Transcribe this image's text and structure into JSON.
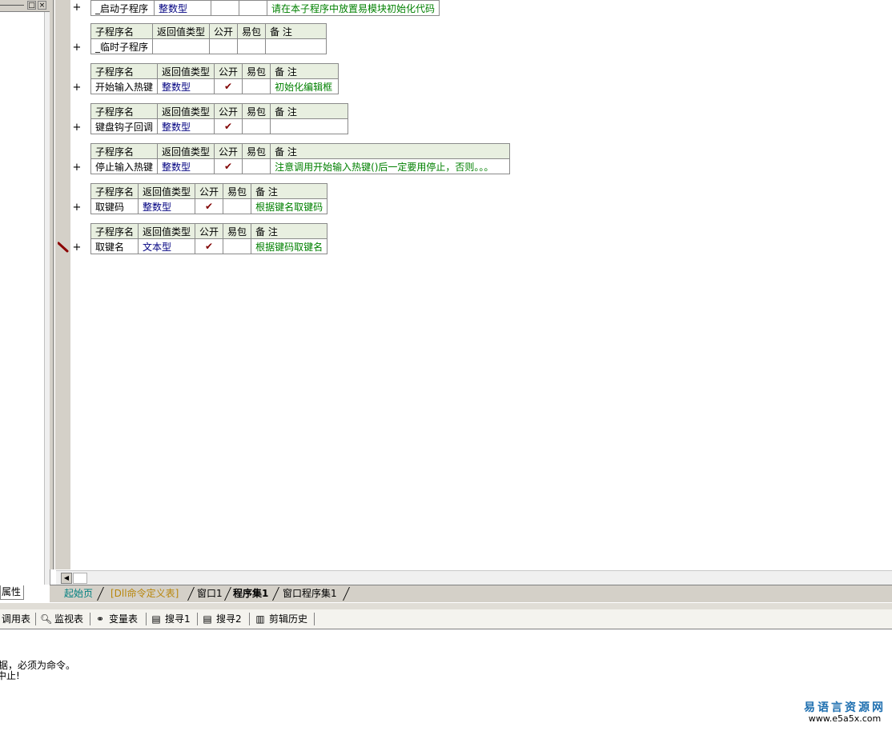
{
  "left_panel": {
    "buttons": [
      "□",
      "×"
    ],
    "properties_tab": "属性"
  },
  "procedures": [
    {
      "header": [
        "子程序名",
        "返回值类型",
        "公开",
        "易包",
        "备 注"
      ],
      "name": "_启动子程序",
      "type": "整数型",
      "public": "",
      "pkg": "",
      "note": "请在本子程序中放置易模块初始化代码"
    },
    {
      "header": [
        "子程序名",
        "返回值类型",
        "公开",
        "易包",
        "备 注"
      ],
      "name": "_临时子程序",
      "type": "",
      "public": "",
      "pkg": "",
      "note": ""
    },
    {
      "header": [
        "子程序名",
        "返回值类型",
        "公开",
        "易包",
        "备 注"
      ],
      "name": "开始输入热键",
      "type": "整数型",
      "public": "✔",
      "pkg": "",
      "note": "初始化编辑框"
    },
    {
      "header": [
        "子程序名",
        "返回值类型",
        "公开",
        "易包",
        "备 注"
      ],
      "name": "键盘钩子回调",
      "type": "整数型",
      "public": "✔",
      "pkg": "",
      "note": ""
    },
    {
      "header": [
        "子程序名",
        "返回值类型",
        "公开",
        "易包",
        "备 注"
      ],
      "name": "停止输入热键",
      "type": "整数型",
      "public": "✔",
      "pkg": "",
      "note": "注意调用开始输入热键()后一定要用停止，否则。。。"
    },
    {
      "header": [
        "子程序名",
        "返回值类型",
        "公开",
        "易包",
        "备 注"
      ],
      "name": "取键码",
      "type": "整数型",
      "public": "✔",
      "pkg": "",
      "note": "根据键名取键码"
    },
    {
      "header": [
        "子程序名",
        "返回值类型",
        "公开",
        "易包",
        "备 注"
      ],
      "name": "取键名",
      "type": "文本型",
      "public": "✔",
      "pkg": "",
      "note": "根据键码取键名"
    }
  ],
  "plus_symbol": "+",
  "tabs": [
    "起始页",
    "[Dll命令定义表]",
    "窗口1",
    "程序集1",
    "窗口程序集1"
  ],
  "toolbar": [
    "调用表",
    "监视表",
    "变量表",
    "搜寻1",
    "搜寻2",
    "剪辑历史"
  ],
  "output_lines": [
    "据，必须为命令。",
    "中止!"
  ],
  "watermark": {
    "title": "易语言资源网",
    "url": "www.e5a5x.com"
  }
}
